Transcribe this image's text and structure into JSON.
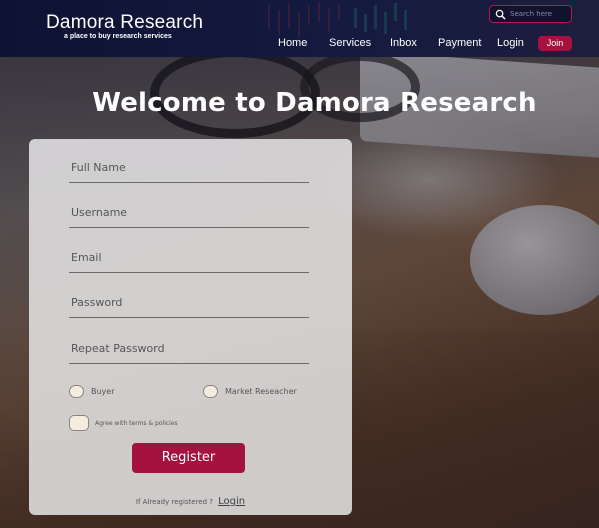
{
  "header": {
    "brand_name": "Damora Research",
    "brand_tagline": "a place to buy research services",
    "search_placeholder": "Search here",
    "nav": [
      "Home",
      "Services",
      "Inbox",
      "Payment",
      "Login"
    ],
    "join_label": "Join"
  },
  "main": {
    "welcome": "Welcome to Damora Research"
  },
  "form": {
    "fields": [
      {
        "placeholder": "Full Name"
      },
      {
        "placeholder": "Username"
      },
      {
        "placeholder": "Email"
      },
      {
        "placeholder": "Password"
      },
      {
        "placeholder": "Repeat Password"
      }
    ],
    "roles": [
      "Buyer",
      "Market Reseacher"
    ],
    "agree_label": "Agree with terms & policies",
    "register_label": "Register",
    "already_text": "If Already registered ?",
    "login_link": "Login"
  },
  "colors": {
    "accent": "#a6123f",
    "header_bg": "#0e1333",
    "card_bg": "#e2e1e2"
  },
  "icons": [
    "search-icon"
  ]
}
